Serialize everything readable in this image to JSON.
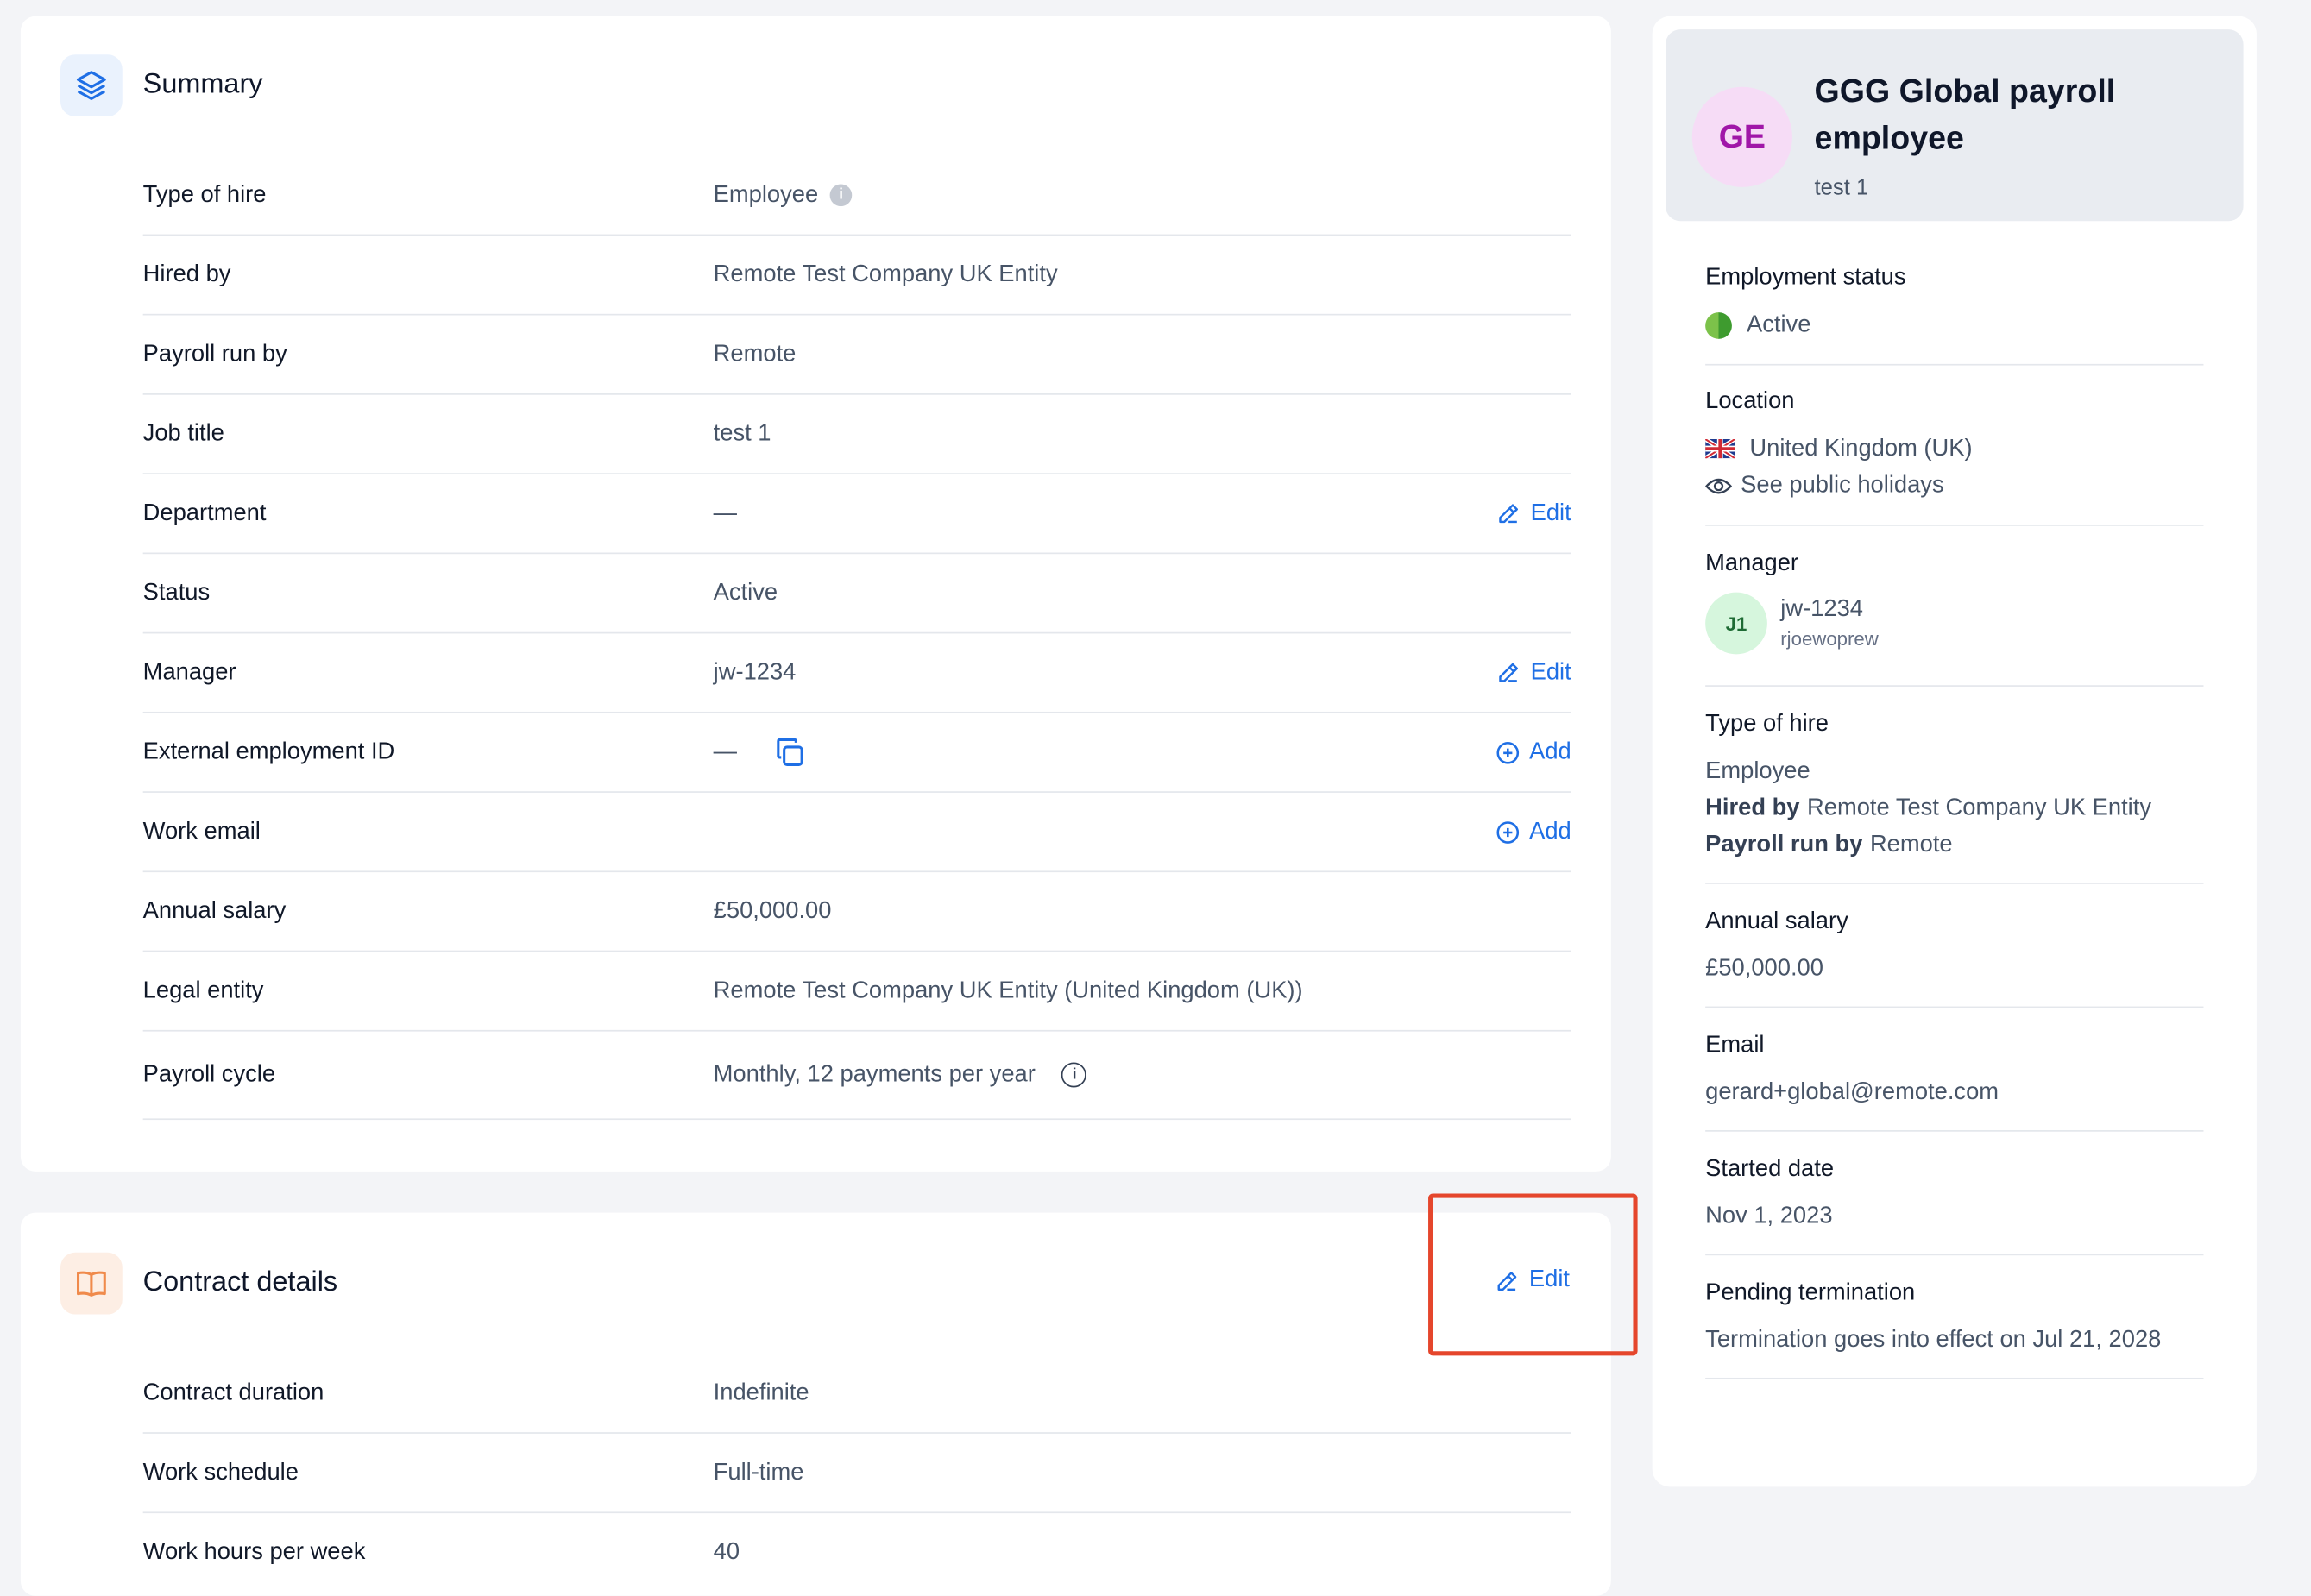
{
  "summary": {
    "title": "Summary",
    "rows": [
      {
        "label": "Type of hire",
        "value": "Employee"
      },
      {
        "label": "Hired by",
        "value": "Remote Test Company UK Entity"
      },
      {
        "label": "Payroll run by",
        "value": "Remote"
      },
      {
        "label": "Job title",
        "value": "test 1"
      },
      {
        "label": "Department",
        "value": "—",
        "action": "Edit"
      },
      {
        "label": "Status",
        "value": "Active"
      },
      {
        "label": "Manager",
        "value": "jw-1234",
        "action": "Edit"
      },
      {
        "label": "External employment ID",
        "value": "—",
        "action": "Add"
      },
      {
        "label": "Work email",
        "value": "",
        "action": "Add"
      },
      {
        "label": "Annual salary",
        "value": "£50,000.00"
      },
      {
        "label": "Legal entity",
        "value": "Remote Test Company UK Entity (United Kingdom (UK))"
      },
      {
        "label": "Payroll cycle",
        "value": "Monthly, 12 payments per year"
      }
    ]
  },
  "contract": {
    "title": "Contract details",
    "edit_label": "Edit",
    "rows": [
      {
        "label": "Contract duration",
        "value": "Indefinite"
      },
      {
        "label": "Work schedule",
        "value": "Full-time"
      },
      {
        "label": "Work hours per week",
        "value": "40"
      }
    ]
  },
  "profile": {
    "initials": "GE",
    "name": "GGG Global payroll employee",
    "job": "test 1"
  },
  "side": {
    "employment_status": {
      "title": "Employment status",
      "value": "Active"
    },
    "location": {
      "title": "Location",
      "country": "United Kingdom (UK)",
      "holidays_link": "See public holidays"
    },
    "manager": {
      "title": "Manager",
      "initials": "J1",
      "name": "jw-1234",
      "username": "rjoewoprew"
    },
    "type_of_hire": {
      "title": "Type of hire",
      "value": "Employee",
      "hired_by_label": "Hired by",
      "hired_by": "Remote Test Company UK Entity",
      "payroll_label": "Payroll run by",
      "payroll": "Remote"
    },
    "annual_salary": {
      "title": "Annual salary",
      "value": "£50,000.00"
    },
    "email": {
      "title": "Email",
      "value": "gerard+global@remote.com"
    },
    "started": {
      "title": "Started date",
      "value": "Nov 1, 2023"
    },
    "pending_termination": {
      "title": "Pending termination",
      "value": "Termination goes into effect on Jul 21, 2028"
    }
  },
  "colors": {
    "accent": "#1f6fe5",
    "highlight": "#e5462c",
    "background": "#f3f4f7"
  }
}
